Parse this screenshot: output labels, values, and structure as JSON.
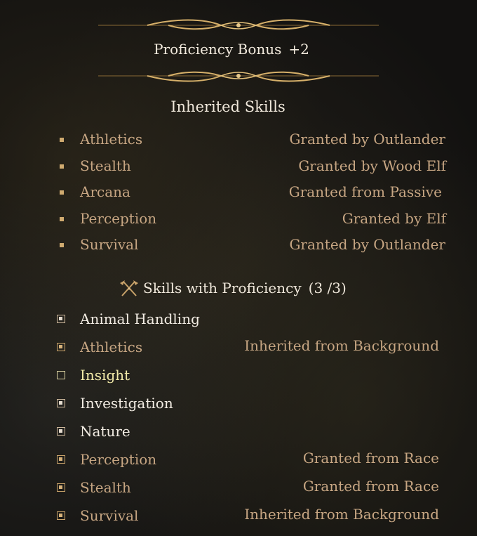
{
  "colors": {
    "accent_gold": "#d0ab70",
    "label_tan": "#c7a683",
    "text_white": "#f2ece3",
    "highlight_yellow": "#f1e9a8"
  },
  "proficiency": {
    "label": "Proficiency Bonus",
    "value": "+2"
  },
  "inherited": {
    "title": "Inherited Skills",
    "items": [
      {
        "name": "Athletics",
        "source": "Granted by Outlander"
      },
      {
        "name": "Stealth",
        "source": "Granted by Wood Elf"
      },
      {
        "name": "Arcana",
        "source": "Granted from Passive"
      },
      {
        "name": "Perception",
        "source": "Granted by Elf"
      },
      {
        "name": "Survival",
        "source": "Granted by Outlander"
      }
    ]
  },
  "proficient": {
    "title": "Skills with Proficiency",
    "count": "(3 /3)",
    "icon": "crossed-axes-icon",
    "items": [
      {
        "name": "Animal Handling",
        "source": "",
        "state": "selected"
      },
      {
        "name": "Athletics",
        "source": "Inherited from Background",
        "state": "inherited"
      },
      {
        "name": "Insight",
        "source": "",
        "state": "unselected"
      },
      {
        "name": "Investigation",
        "source": "",
        "state": "selected"
      },
      {
        "name": "Nature",
        "source": "",
        "state": "selected"
      },
      {
        "name": "Perception",
        "source": "Granted from Race",
        "state": "inherited"
      },
      {
        "name": "Stealth",
        "source": "Granted from Race",
        "state": "inherited"
      },
      {
        "name": "Survival",
        "source": "Inherited from Background",
        "state": "inherited"
      }
    ]
  }
}
